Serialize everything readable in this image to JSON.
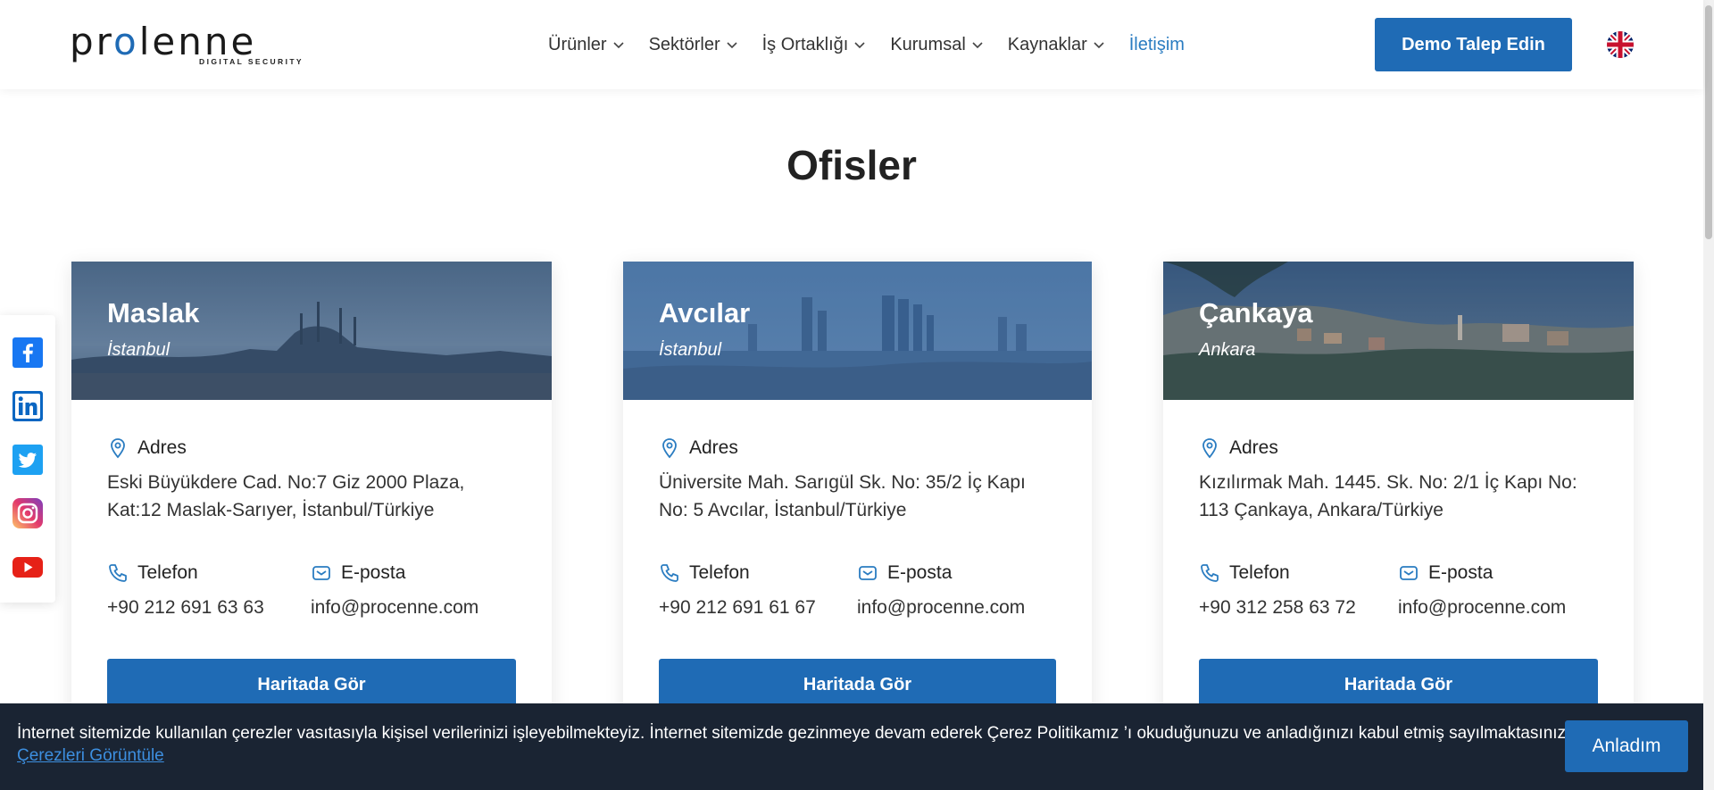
{
  "header": {
    "logo_word_part1": "pr",
    "logo_word_part2": "o",
    "logo_word_part3": "lenne",
    "logo_tagline": "DIGITAL SECURITY",
    "nav": [
      {
        "label": "Ürünler",
        "has_dropdown": true
      },
      {
        "label": "Sektörler",
        "has_dropdown": true
      },
      {
        "label": "İş Ortaklığı",
        "has_dropdown": true
      },
      {
        "label": "Kurumsal",
        "has_dropdown": true
      },
      {
        "label": "Kaynaklar",
        "has_dropdown": true
      },
      {
        "label": "İletişim",
        "has_dropdown": false,
        "active": true
      }
    ],
    "demo_button": "Demo Talep Edin",
    "language_icon": "uk-flag-icon"
  },
  "page": {
    "title": "Ofisler"
  },
  "social": [
    "facebook-icon",
    "linkedin-icon",
    "twitter-icon",
    "instagram-icon",
    "youtube-icon"
  ],
  "offices": [
    {
      "city": "Maslak",
      "region": "İstanbul",
      "address_label": "Adres",
      "address": "Eski Büyükdere Cad. No:7 Giz 2000 Plaza, Kat:12 Maslak-Sarıyer, İstanbul/Türkiye",
      "phone_label": "Telefon",
      "phone": "+90 212 691 63 63",
      "email_label": "E-posta",
      "email": "info@procenne.com",
      "map_button": "Haritada Gör"
    },
    {
      "city": "Avcılar",
      "region": "İstanbul",
      "address_label": "Adres",
      "address": "Üniversite Mah. Sarıgül Sk. No: 35/2 İç Kapı No: 5 Avcılar, İstanbul/Türkiye",
      "phone_label": "Telefon",
      "phone": "+90 212 691 61 67",
      "email_label": "E-posta",
      "email": "info@procenne.com",
      "map_button": "Haritada Gör"
    },
    {
      "city": "Çankaya",
      "region": "Ankara",
      "address_label": "Adres",
      "address": "Kızılırmak Mah. 1445. Sk. No: 2/1 İç Kapı No: 113 Çankaya, Ankara/Türkiye",
      "phone_label": "Telefon",
      "phone": "+90 312 258 63 72",
      "email_label": "E-posta",
      "email": "info@procenne.com",
      "map_button": "Haritada Gör"
    }
  ],
  "cookie": {
    "text": "İnternet sitemizde kullanılan çerezler vasıtasıyla kişisel verilerinizi işleyebilmekteyiz. İnternet sitemizde gezinmeye devam ederek Çerez Politikamız ’ı okuduğunuzu ve anladığınızı kabul etmiş sayılmaktasınız.",
    "link": "Çerezleri Görüntüle",
    "button": "Anladım"
  },
  "colors": {
    "brand_blue": "#1f6bb5",
    "active_nav": "#2a7cc1",
    "cookie_bg": "#1a2433"
  }
}
